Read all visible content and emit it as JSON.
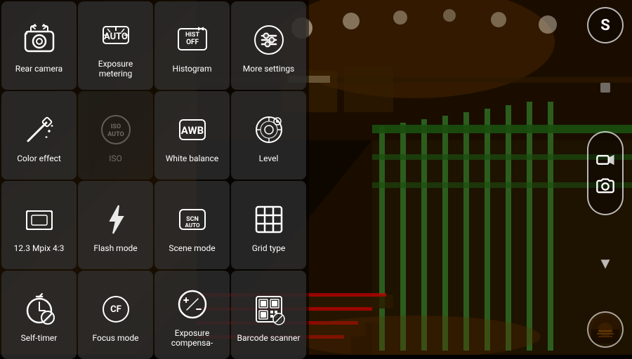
{
  "settings": [
    {
      "id": "rear-camera",
      "label": "Rear camera",
      "icon": "camera-flip"
    },
    {
      "id": "exposure-metering",
      "label": "Exposure metering",
      "icon": "exposure-meter"
    },
    {
      "id": "histogram",
      "label": "Histogram",
      "icon": "histogram"
    },
    {
      "id": "more-settings",
      "label": "More settings",
      "icon": "sliders"
    },
    {
      "id": "color-effect",
      "label": "Color effect",
      "icon": "wand"
    },
    {
      "id": "iso",
      "label": "ISO",
      "icon": "iso-auto"
    },
    {
      "id": "white-balance",
      "label": "White balance",
      "icon": "awb"
    },
    {
      "id": "level",
      "label": "Level",
      "icon": "level"
    },
    {
      "id": "mpix",
      "label": "12.3 Mpix 4:3",
      "icon": "resolution"
    },
    {
      "id": "flash-mode",
      "label": "Flash mode",
      "icon": "flash"
    },
    {
      "id": "scene-mode",
      "label": "Scene mode",
      "icon": "scene-auto"
    },
    {
      "id": "grid-type",
      "label": "Grid type",
      "icon": "grid"
    },
    {
      "id": "self-timer",
      "label": "Self-timer",
      "icon": "timer"
    },
    {
      "id": "focus-mode",
      "label": "Focus mode",
      "icon": "focus-cf"
    },
    {
      "id": "exposure-comp",
      "label": "Exposure compensa-",
      "icon": "exposure-comp"
    },
    {
      "id": "barcode-scanner",
      "label": "Barcode scanner",
      "icon": "barcode"
    }
  ],
  "right_panel": {
    "top_btn_label": "S",
    "arrow_label": "▼"
  }
}
